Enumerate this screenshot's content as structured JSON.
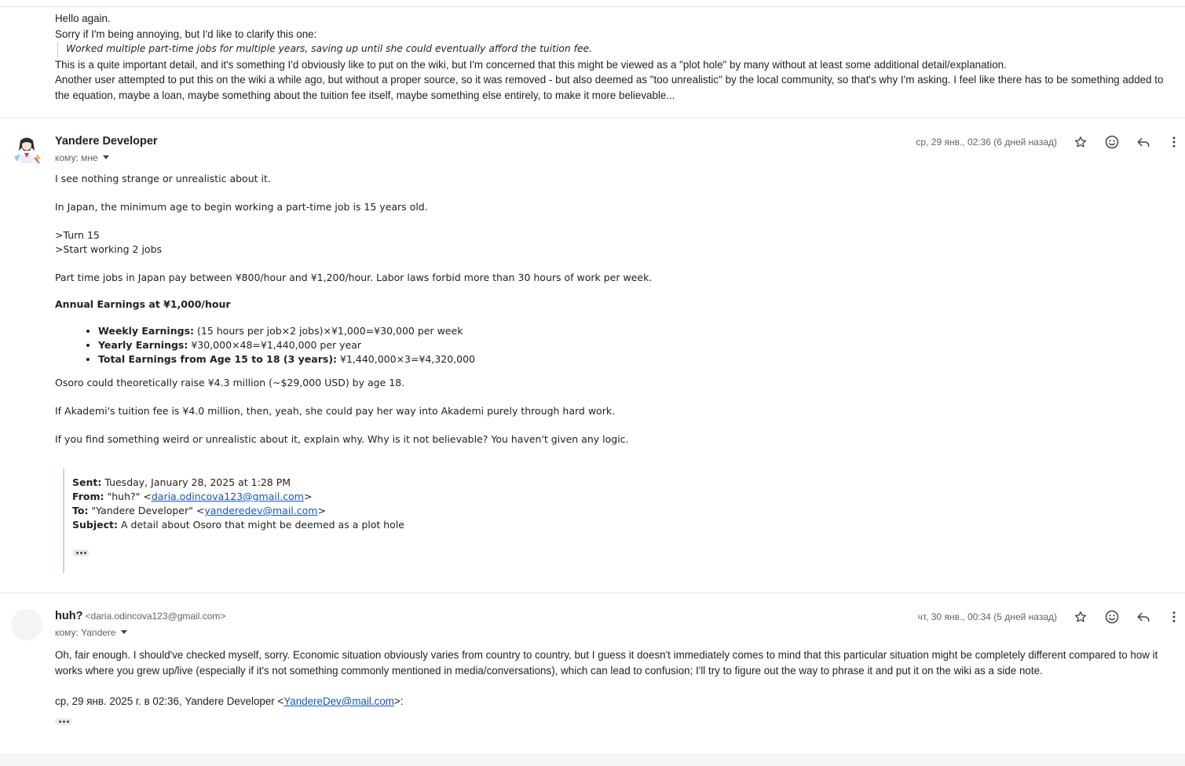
{
  "message1": {
    "lines": [
      "Hello again.",
      "Sorry if I'm being annoying, but I'd like to clarify this one:"
    ],
    "quote": "Worked multiple part-time jobs for multiple years, saving up until she could eventually afford the tuition fee.",
    "after": [
      "This is a quite important detail, and it's something I'd obviously like to put on the wiki, but I'm concerned that this might be viewed as a \"plot hole\" by many without at least some additional detail/explanation.",
      "Another user attempted to put this on the wiki a while ago, but without a proper source, so it was removed - but also deemed as \"too unrealistic\" by the local community, so that's why I'm asking. I feel like there has to be something added to the equation, maybe a loan, maybe something about the tuition fee itself, maybe something else entirely, to make it more believable..."
    ]
  },
  "message2": {
    "sender_name": "Yandere Developer",
    "recipient": "кому: мне",
    "date": "ср, 29 янв., 02:36 (6 дней назад)",
    "paragraphs": {
      "p1": "I see nothing strange or unrealistic about it.",
      "p2": "In Japan, the minimum age to begin working a part-time job is 15 years old.",
      "p3a": ">Turn 15",
      "p3b": ">Start working 2 jobs",
      "p4": "Part time jobs in Japan pay between ¥800/hour and ¥1,200/hour. Labor laws forbid more than 30 hours of work per week.",
      "heading": "Annual Earnings at ¥1,000/hour",
      "p5": "Osoro could theoretically raise ¥4.3 million (~$29,000 USD) by age 18.",
      "p6": "If Akademi's tuition fee is ¥4.0 million, then, yeah, she could pay her way into Akademi purely through hard work.",
      "p7": "If you find something weird or unrealistic about it, explain why. Why is it not believable? You haven't given any logic."
    },
    "bullets": [
      {
        "label": "Weekly Earnings:",
        "text": " (15 hours per job×2 jobs)×¥1,000=¥30,000 per week"
      },
      {
        "label": "Yearly Earnings:",
        "text": " ¥30,000×48=¥1,440,000 per year"
      },
      {
        "label": "Total Earnings from Age 15 to 18 (3 years):",
        "text": " ¥1,440,000×3=¥4,320,000"
      }
    ],
    "quoted_header": {
      "sent_label": "Sent:",
      "sent_value": " Tuesday, January 28, 2025 at 1:28 PM",
      "from_label": "From:",
      "from_name": " \"huh?\" <",
      "from_email": "daria.odincova123@gmail.com",
      "from_end": ">",
      "to_label": "To:",
      "to_name": " \"Yandere Developer\" <",
      "to_email": "yanderedev@mail.com",
      "to_end": ">",
      "subject_label": "Subject:",
      "subject_value": " A detail about Osoro that might be deemed as a plot hole"
    }
  },
  "message3": {
    "sender_name": "huh?",
    "sender_email": "<daria.odincova123@gmail.com>",
    "recipient": "кому: Yandere",
    "date": "чт, 30 янв., 00:34 (5 дней назад)",
    "body": "Oh, fair enough. I should've checked myself, sorry. Economic situation obviously varies from country to country, but I guess it doesn't immediately comes to mind that this particular situation might be completely different compared to how it works where you grew up/live (especially if it's not something commonly mentioned in media/conversations), which can lead to confusion; I'll try to figure out the way to phrase it and put it on the wiki as a side note.",
    "quote_intro": "ср, 29 янв. 2025 г. в 02:36, Yandere Developer <",
    "quote_email": "YandereDev@mail.com",
    "quote_end": ">:"
  },
  "icons": [
    "star-icon",
    "emoji-icon",
    "reply-icon",
    "more-vert-icon",
    "caret-down-icon",
    "ellipsis-icon"
  ]
}
